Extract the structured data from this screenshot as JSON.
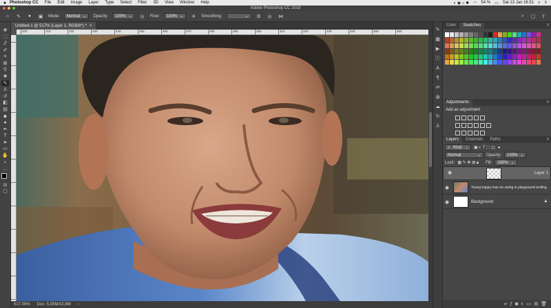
{
  "menubar": {
    "apple": "",
    "app_name": "Photoshop CC",
    "items": [
      "File",
      "Edit",
      "Image",
      "Layer",
      "Type",
      "Select",
      "Filter",
      "3D",
      "View",
      "Window",
      "Help"
    ],
    "battery": "54 %",
    "clock": "Sat 13 Jan 16.51"
  },
  "titlebar": {
    "title": "Adobe Photoshop CC 2018"
  },
  "options": {
    "mode_label": "Mode:",
    "mode_value": "Normal",
    "opacity_label": "Opacity:",
    "opacity_value": "100%",
    "flow_label": "Flow:",
    "flow_value": "100%",
    "smoothing_label": "Smoothing:",
    "smoothing_value": ""
  },
  "document": {
    "tab_title": "Untitled-1 @ 517% (Layer 1, RGB/8*) *",
    "ruler_ticks": [
      "200",
      "210",
      "220",
      "230",
      "240",
      "250",
      "260",
      "270",
      "280",
      "290",
      "300",
      "310",
      "320",
      "330",
      "340",
      "350",
      "360"
    ],
    "zoom": "517.09%",
    "doc_info": "Doc: 5,93M/10,8M"
  },
  "panels": {
    "color_tab": "Color",
    "swatches_tab": "Swatches",
    "adjustments_title": "Adjustments",
    "add_adjustment": "Add an adjustment",
    "layers_tab": "Layers",
    "channels_tab": "Channels",
    "paths_tab": "Paths",
    "kind_value": "Kind",
    "blend_mode": "Normal",
    "opacity_label": "Opacity:",
    "opacity_value": "100%",
    "lock_label": "Lock:",
    "fill_label": "Fill:",
    "fill_value": "100%",
    "layers": [
      {
        "name": "Layer 1",
        "selected": true,
        "thumb": "transparent"
      },
      {
        "name": "Young happy man on swing in playground smiling",
        "selected": false,
        "thumb": "photo"
      },
      {
        "name": "Background",
        "selected": false,
        "thumb": "white"
      }
    ]
  },
  "colors": {
    "menubar_bg": "#e9e9e9",
    "panel_bg": "#464646",
    "options_bg": "#434343",
    "selected_layer": "#646464"
  }
}
